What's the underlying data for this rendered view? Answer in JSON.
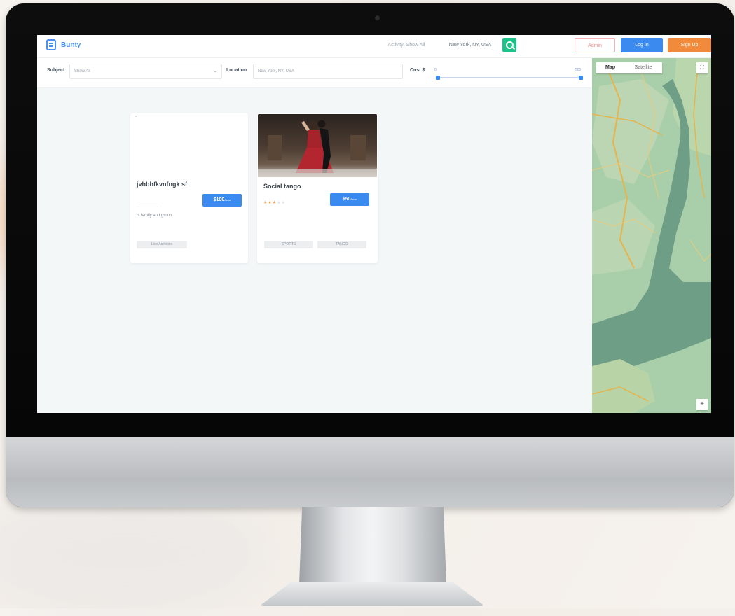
{
  "app": {
    "logo_text": "Bunty"
  },
  "header": {
    "subject_value": "Activity: Show All",
    "location_value": "New York, NY, USA",
    "outline_button": "Admin",
    "login_button": "Log In",
    "signup_button": "Sign Up"
  },
  "filters": {
    "subject_label": "Subject",
    "subject_value": "Show All",
    "location_label": "Location",
    "location_value": "New York, NY, USA",
    "cost_label": "Cost $",
    "cost_min": "0",
    "cost_max": "500"
  },
  "cards": [
    {
      "title": "jvhbhfkvnfngk sf",
      "price": "$100",
      "price_unit": "/hour",
      "rating_filled": 0,
      "subtitle": "is family and group",
      "tags": [
        "Live Activities"
      ]
    },
    {
      "title": "Social tango",
      "price": "$50",
      "price_unit": "/hour",
      "rating_filled": 3,
      "subtitle": "",
      "tags": [
        "SPORTS",
        "TANGO"
      ]
    }
  ],
  "map": {
    "tab_map": "Map",
    "tab_satellite": "Satellite",
    "fullscreen_icon": "fullscreen-icon",
    "zoom_in": "+"
  },
  "colors": {
    "primary": "#3b8af0",
    "green": "#1ec38a",
    "orange": "#f28a3c",
    "danger_outline": "#f7b2b2"
  }
}
